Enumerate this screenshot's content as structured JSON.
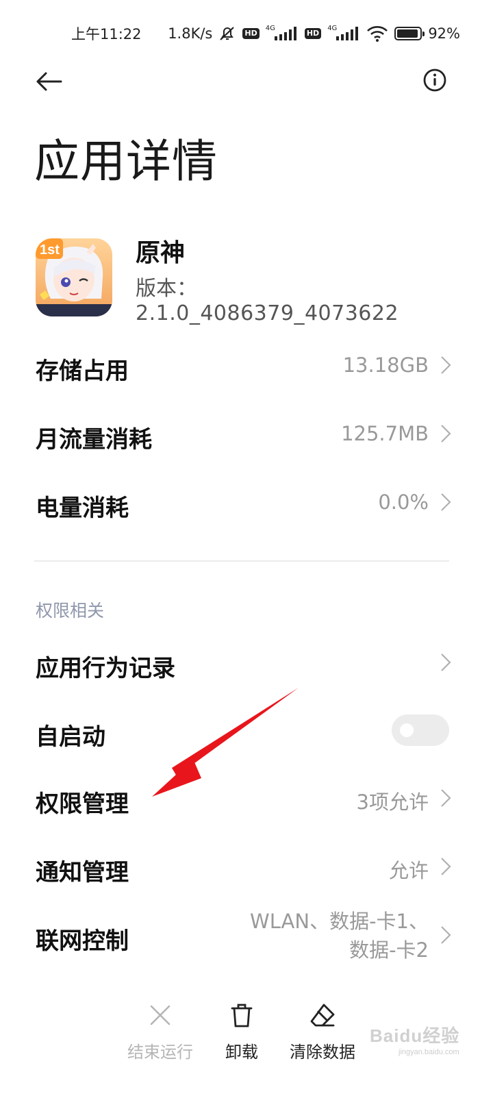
{
  "status_bar": {
    "time": "上午11:22",
    "net_speed": "1.8K/s",
    "hd_badge": "HD",
    "net_type": "4G",
    "battery_text": "92%",
    "battery_level": 0.92,
    "icons": [
      "mute-icon",
      "hd-icon",
      "signal-icon",
      "hd-icon",
      "signal-icon",
      "wifi-icon",
      "battery-icon"
    ]
  },
  "header": {
    "back_icon": "back-arrow-icon",
    "info_icon": "info-icon",
    "title": "应用详情"
  },
  "app": {
    "name": "原神",
    "version_label": "版本：",
    "version": "2.1.0_4086379_4073622",
    "icon_badge": "1st"
  },
  "rows": {
    "storage": {
      "label": "存储占用",
      "value": "13.18GB"
    },
    "traffic": {
      "label": "月流量消耗",
      "value": "125.7MB"
    },
    "battery": {
      "label": "电量消耗",
      "value": "0.0%"
    }
  },
  "permissions_section": {
    "title": "权限相关",
    "behavior": {
      "label": "应用行为记录"
    },
    "autostart": {
      "label": "自启动",
      "enabled": false
    },
    "permission_mgmt": {
      "label": "权限管理",
      "value": "3项允许"
    },
    "notification_mgmt": {
      "label": "通知管理",
      "value": "允许"
    },
    "network_ctrl": {
      "label": "联网控制",
      "value_line1": "WLAN、数据-卡1、",
      "value_line2": "数据-卡2"
    }
  },
  "actions": {
    "stop": {
      "label": "结束运行",
      "icon": "close-icon",
      "enabled": false
    },
    "uninstall": {
      "label": "卸载",
      "icon": "trash-icon"
    },
    "clear": {
      "label": "清除数据",
      "icon": "eraser-icon"
    }
  },
  "watermark": {
    "text": "Baidu经验",
    "sub": "jingyan.baidu.com"
  },
  "colors": {
    "annotation_arrow": "#e8161c",
    "secondary_text": "#999999",
    "section_title": "#8f97ab"
  }
}
